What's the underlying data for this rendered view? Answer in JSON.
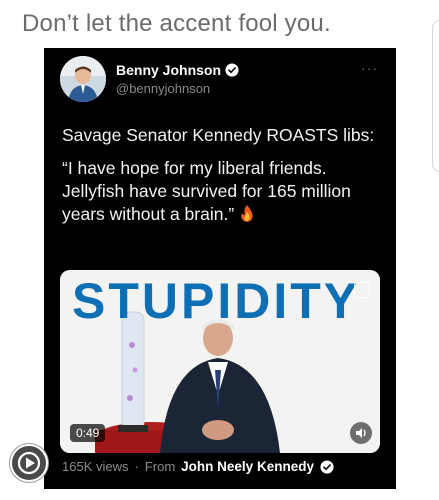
{
  "caption": "Don’t let the accent fool you.",
  "tweet": {
    "author_name": "Benny Johnson",
    "handle": "@bennyjohnson",
    "more_label": "···",
    "text_line1": "Savage Senator Kennedy ROASTS libs:",
    "text_line2": "“I have hope for my liberal friends. Jellyfish have survived for 165 million years without a brain.”",
    "video": {
      "overlay_title": "STUPIDITY",
      "duration": "0:49"
    },
    "footer": {
      "views": "165K views",
      "separator": "·",
      "from_label": "From",
      "from_name": "John Neely Kennedy"
    }
  },
  "colors": {
    "tweet_bg": "#000000",
    "verified_blue": "#ffffff",
    "stupidity_blue": "#0f6fb4",
    "caption_gray": "#6b6b6b"
  }
}
